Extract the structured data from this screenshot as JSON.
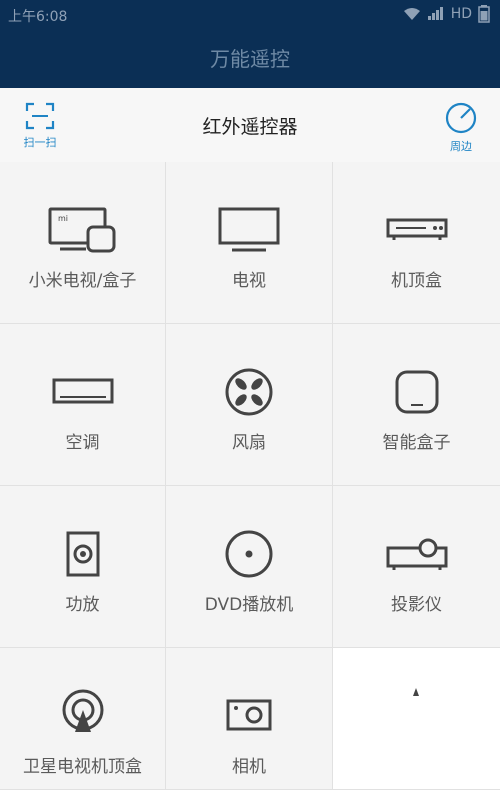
{
  "status": {
    "time": "上午6:08",
    "network": "HD"
  },
  "app": {
    "title": "万能遥控"
  },
  "toolbar": {
    "title": "红外遥控器",
    "scan_label": "扫一扫",
    "nearby_label": "周边"
  },
  "devices": [
    {
      "label": "小米电视/盒子",
      "icon": "mi-tv-box-icon"
    },
    {
      "label": "电视",
      "icon": "tv-icon"
    },
    {
      "label": "机顶盒",
      "icon": "set-top-box-icon"
    },
    {
      "label": "空调",
      "icon": "air-conditioner-icon"
    },
    {
      "label": "风扇",
      "icon": "fan-icon"
    },
    {
      "label": "智能盒子",
      "icon": "smart-box-icon"
    },
    {
      "label": "功放",
      "icon": "amplifier-speaker-icon"
    },
    {
      "label": "DVD播放机",
      "icon": "dvd-player-icon"
    },
    {
      "label": "投影仪",
      "icon": "projector-icon"
    },
    {
      "label": "卫星电视机顶盒",
      "icon": "satellite-dish-icon"
    },
    {
      "label": "相机",
      "icon": "camera-icon"
    }
  ]
}
